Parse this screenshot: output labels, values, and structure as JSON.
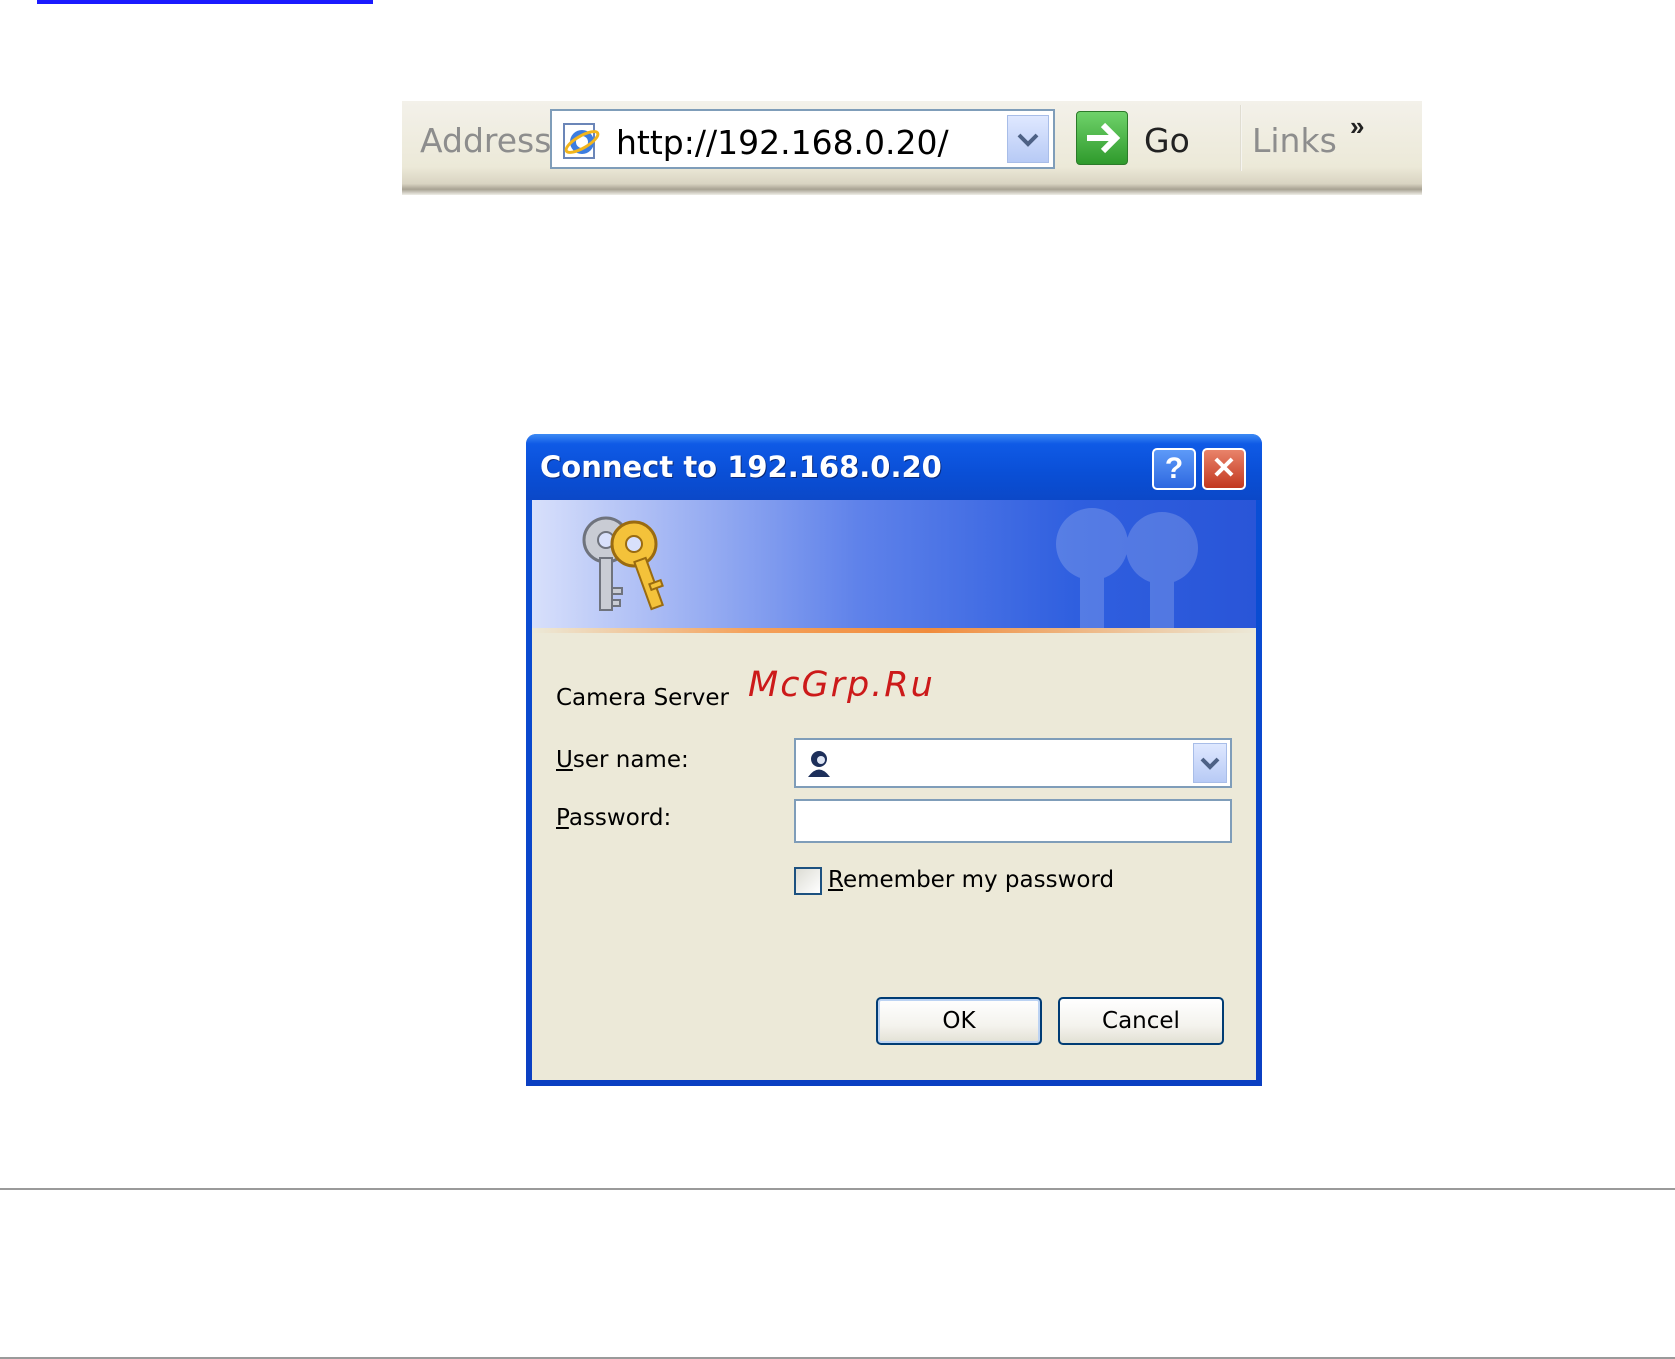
{
  "address_bar": {
    "label": "Address",
    "url": "http://192.168.0.20/",
    "go_label": "Go",
    "links_label": "Links",
    "chevron": "»"
  },
  "dialog": {
    "title": "Connect to 192.168.0.20",
    "help_glyph": "?",
    "close_glyph": "✕",
    "realm": "Camera Server",
    "watermark": "McGrp.Ru",
    "user_label_u": "U",
    "user_label_rest": "ser name:",
    "password_label_u": "P",
    "password_label_rest": "assword:",
    "user_value": "",
    "password_value": "",
    "remember_u": "R",
    "remember_rest": "emember my password",
    "remember_checked": false,
    "ok_label": "OK",
    "cancel_label": "Cancel"
  },
  "colors": {
    "title_bar": "#0a4fd6",
    "dialog_body": "#ece9d8",
    "watermark": "#cc1a1a",
    "go_green": "#2f9a2c"
  }
}
